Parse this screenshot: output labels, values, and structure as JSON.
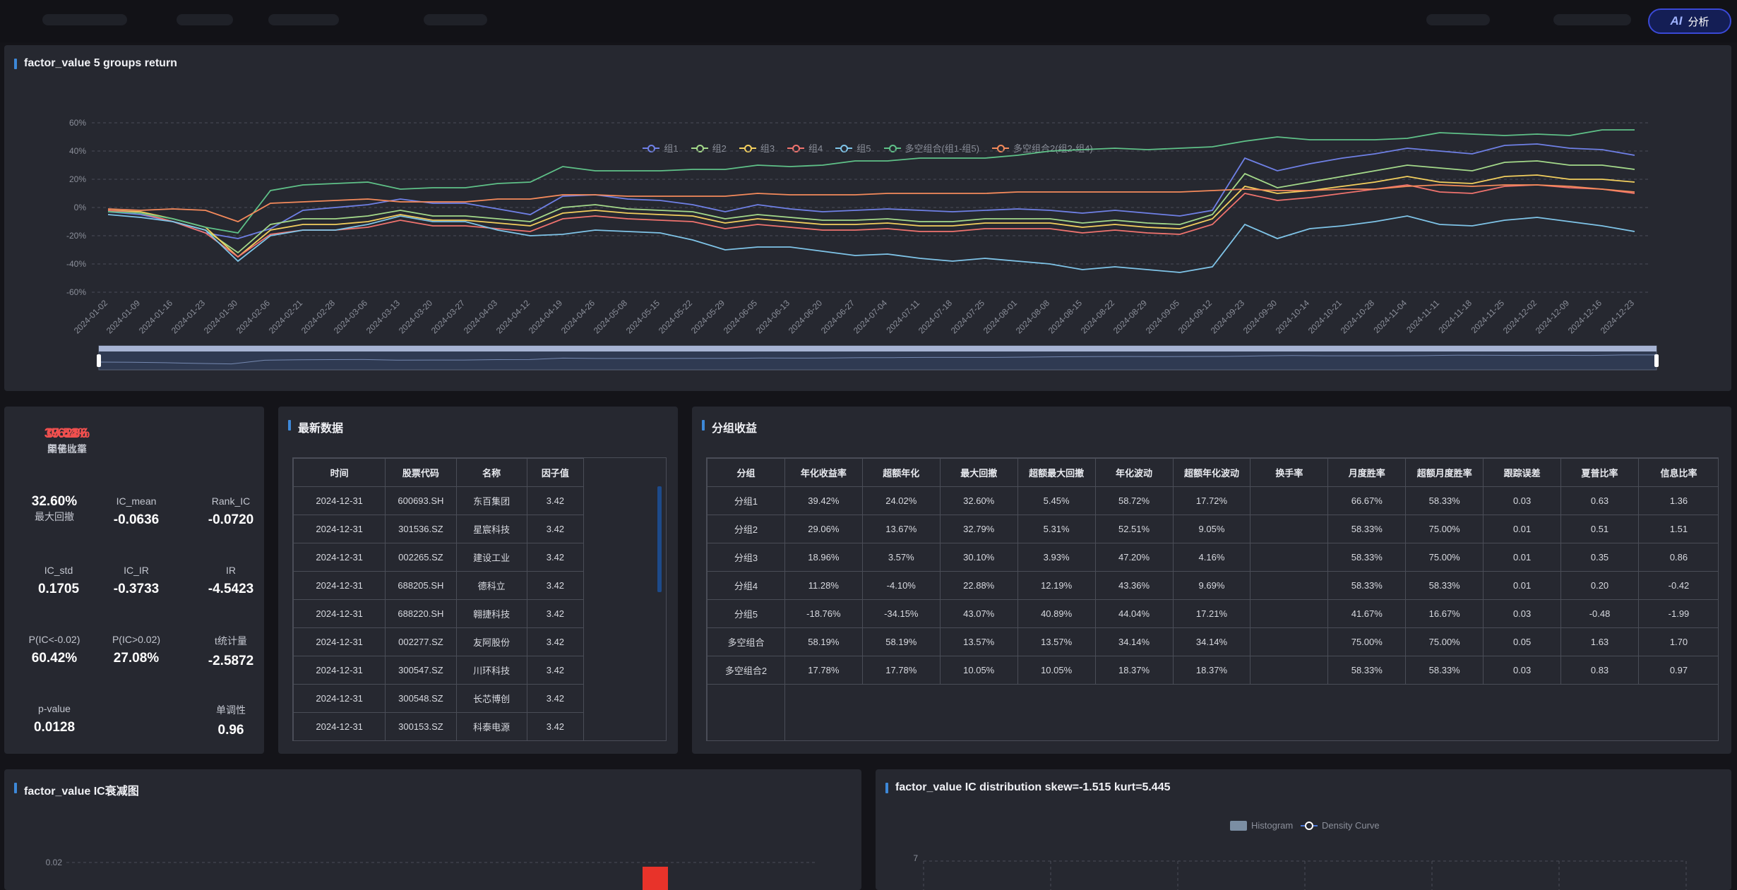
{
  "header": {
    "ai_label": "分析",
    "ai_icon": "AI"
  },
  "chart1": {
    "title": "factor_value 5 groups return",
    "legend": [
      {
        "name": "组1",
        "color": "#6f80e6"
      },
      {
        "name": "组2",
        "color": "#a4d98a"
      },
      {
        "name": "组3",
        "color": "#f3cf5e"
      },
      {
        "name": "组4",
        "color": "#f0736e"
      },
      {
        "name": "组5",
        "color": "#7fc4e8"
      },
      {
        "name": "多空组合(组1-组5)",
        "color": "#5fc188"
      },
      {
        "name": "多空组合2(组2-组4)",
        "color": "#f58a5b"
      }
    ]
  },
  "chart_data": [
    {
      "type": "line",
      "title": "factor_value 5 groups return",
      "x": [
        "2024-01-02",
        "2024-01-09",
        "2024-01-16",
        "2024-01-23",
        "2024-01-30",
        "2024-02-06",
        "2024-02-21",
        "2024-02-28",
        "2024-03-06",
        "2024-03-13",
        "2024-03-20",
        "2024-03-27",
        "2024-04-03",
        "2024-04-12",
        "2024-04-19",
        "2024-04-26",
        "2024-05-08",
        "2024-05-15",
        "2024-05-22",
        "2024-05-29",
        "2024-06-05",
        "2024-06-13",
        "2024-06-20",
        "2024-06-27",
        "2024-07-04",
        "2024-07-11",
        "2024-07-18",
        "2024-07-25",
        "2024-08-01",
        "2024-08-08",
        "2024-08-15",
        "2024-08-22",
        "2024-08-29",
        "2024-09-05",
        "2024-09-12",
        "2024-09-23",
        "2024-09-30",
        "2024-10-14",
        "2024-10-21",
        "2024-10-28",
        "2024-11-04",
        "2024-11-11",
        "2024-11-18",
        "2024-11-25",
        "2024-12-02",
        "2024-12-09",
        "2024-12-16",
        "2024-12-23"
      ],
      "yunit": "%",
      "ylim": [
        -60,
        60
      ],
      "yticks": [
        60,
        40,
        20,
        0,
        -20,
        -40,
        -60
      ],
      "grid": true,
      "legend": "top-center",
      "series": [
        {
          "name": "组1",
          "values": [
            -3,
            -5,
            -10,
            -18,
            -22,
            -15,
            -2,
            0,
            2,
            6,
            3,
            3,
            -1,
            -5,
            8,
            9,
            6,
            5,
            2,
            -3,
            2,
            -1,
            -3,
            -2,
            -1,
            -2,
            -3,
            -2,
            -1,
            -2,
            -4,
            -2,
            -4,
            -6,
            -2,
            35,
            26,
            31,
            35,
            38,
            42,
            40,
            38,
            44,
            45,
            42,
            41,
            37
          ]
        },
        {
          "name": "组2",
          "values": [
            -2,
            -4,
            -10,
            -16,
            -32,
            -12,
            -8,
            -8,
            -6,
            -2,
            -6,
            -6,
            -8,
            -10,
            0,
            2,
            -1,
            -2,
            -3,
            -8,
            -5,
            -7,
            -9,
            -9,
            -8,
            -10,
            -10,
            -8,
            -8,
            -8,
            -11,
            -9,
            -11,
            -12,
            -5,
            24,
            14,
            18,
            22,
            26,
            30,
            28,
            26,
            32,
            33,
            30,
            30,
            27
          ]
        },
        {
          "name": "组3",
          "values": [
            -2,
            -3,
            -8,
            -14,
            -35,
            -16,
            -12,
            -12,
            -10,
            -5,
            -9,
            -9,
            -11,
            -13,
            -4,
            -2,
            -4,
            -5,
            -6,
            -11,
            -8,
            -10,
            -12,
            -12,
            -11,
            -13,
            -13,
            -11,
            -11,
            -11,
            -14,
            -12,
            -14,
            -15,
            -8,
            15,
            10,
            12,
            15,
            18,
            22,
            18,
            17,
            22,
            23,
            20,
            20,
            18
          ]
        },
        {
          "name": "组4",
          "values": [
            -2,
            -4,
            -10,
            -18,
            -35,
            -19,
            -16,
            -16,
            -14,
            -9,
            -13,
            -13,
            -15,
            -17,
            -8,
            -6,
            -8,
            -9,
            -10,
            -15,
            -12,
            -14,
            -16,
            -16,
            -15,
            -17,
            -17,
            -15,
            -15,
            -15,
            -18,
            -16,
            -18,
            -19,
            -12,
            10,
            5,
            7,
            10,
            13,
            16,
            11,
            10,
            15,
            16,
            14,
            13,
            10
          ]
        },
        {
          "name": "组5",
          "values": [
            -5,
            -7,
            -10,
            -16,
            -38,
            -20,
            -16,
            -16,
            -12,
            -6,
            -10,
            -10,
            -16,
            -20,
            -19,
            -16,
            -17,
            -18,
            -23,
            -30,
            -28,
            -28,
            -31,
            -34,
            -33,
            -36,
            -38,
            -36,
            -38,
            -40,
            -44,
            -42,
            -44,
            -46,
            -42,
            -12,
            -22,
            -15,
            -13,
            -10,
            -6,
            -12,
            -13,
            -9,
            -7,
            -10,
            -13,
            -17
          ]
        },
        {
          "name": "多空组合(组1-组5)",
          "values": [
            -3,
            -4,
            -8,
            -14,
            -18,
            12,
            16,
            17,
            18,
            13,
            14,
            14,
            17,
            18,
            29,
            26,
            26,
            26,
            27,
            27,
            30,
            29,
            30,
            33,
            33,
            35,
            35,
            35,
            37,
            40,
            41,
            42,
            41,
            42,
            43,
            47,
            50,
            48,
            48,
            48,
            49,
            53,
            52,
            51,
            52,
            51,
            55,
            55
          ]
        },
        {
          "name": "多空组合2(组2-组4)",
          "values": [
            -1,
            -2,
            -1,
            -2,
            -10,
            3,
            4,
            5,
            6,
            4,
            4,
            4,
            6,
            6,
            9,
            9,
            8,
            8,
            8,
            8,
            10,
            9,
            9,
            9,
            10,
            10,
            10,
            10,
            11,
            11,
            11,
            11,
            11,
            11,
            12,
            13,
            12,
            12,
            13,
            13,
            15,
            16,
            15,
            16,
            16,
            15,
            13,
            11
          ]
        }
      ]
    },
    {
      "type": "bar",
      "title": "factor_value IC衰减图",
      "yticks": [
        0.02
      ],
      "series": [
        {
          "values": [
            0.02
          ]
        }
      ]
    },
    {
      "type": "bar",
      "title": "factor_value IC distribution skew=-1.515 kurt=5.445",
      "legend": [
        "Histogram",
        "Density Curve"
      ],
      "yticks": [
        7
      ]
    }
  ],
  "metrics": [
    {
      "value": "37.54%",
      "label": "因子收益",
      "highlight": true
    },
    {
      "value": "0.6286",
      "label": "夏普比率",
      "highlight": true
    },
    {
      "value": "39.42%",
      "label": "年化收益",
      "highlight": true
    },
    {
      "value": "32.60%",
      "label": "最大回撤"
    },
    {
      "value": "-0.0636",
      "label": "IC_mean"
    },
    {
      "value": "-0.0720",
      "label": "Rank_IC"
    },
    {
      "value": "0.1705",
      "label": "IC_std"
    },
    {
      "value": "-0.3733",
      "label": "IC_IR"
    },
    {
      "value": "-4.5423",
      "label": "IR"
    },
    {
      "value": "60.42%",
      "label": "P(IC<-0.02)"
    },
    {
      "value": "27.08%",
      "label": "P(IC>0.02)"
    },
    {
      "value": "-2.5872",
      "label": "t统计量"
    },
    {
      "value": "0.0128",
      "label": "p-value"
    },
    {
      "value": "0.96",
      "label": "单调性"
    }
  ],
  "latest": {
    "title": "最新数据",
    "headers": [
      "时间",
      "股票代码",
      "名称",
      "因子值"
    ],
    "rows": [
      [
        "2024-12-31",
        "600693.SH",
        "东百集团",
        "3.42"
      ],
      [
        "2024-12-31",
        "301536.SZ",
        "星宸科技",
        "3.42"
      ],
      [
        "2024-12-31",
        "002265.SZ",
        "建设工业",
        "3.42"
      ],
      [
        "2024-12-31",
        "688205.SH",
        "德科立",
        "3.42"
      ],
      [
        "2024-12-31",
        "688220.SH",
        "翱捷科技",
        "3.42"
      ],
      [
        "2024-12-31",
        "002277.SZ",
        "友阿股份",
        "3.42"
      ],
      [
        "2024-12-31",
        "300547.SZ",
        "川环科技",
        "3.42"
      ],
      [
        "2024-12-31",
        "300548.SZ",
        "长芯博创",
        "3.42"
      ],
      [
        "2024-12-31",
        "300153.SZ",
        "科泰电源",
        "3.42"
      ]
    ]
  },
  "groups": {
    "title": "分组收益",
    "headers": [
      "分组",
      "年化收益率",
      "超额年化",
      "最大回撤",
      "超额最大回撤",
      "年化波动",
      "超额年化波动",
      "换手率",
      "月度胜率",
      "超额月度胜率",
      "跟踪误差",
      "夏普比率",
      "信息比率"
    ],
    "rows": [
      [
        "分组1",
        "39.42%",
        "24.02%",
        "32.60%",
        "5.45%",
        "58.72%",
        "17.72%",
        "",
        "66.67%",
        "58.33%",
        "0.03",
        "0.63",
        "1.36"
      ],
      [
        "分组2",
        "29.06%",
        "13.67%",
        "32.79%",
        "5.31%",
        "52.51%",
        "9.05%",
        "",
        "58.33%",
        "75.00%",
        "0.01",
        "0.51",
        "1.51"
      ],
      [
        "分组3",
        "18.96%",
        "3.57%",
        "30.10%",
        "3.93%",
        "47.20%",
        "4.16%",
        "",
        "58.33%",
        "75.00%",
        "0.01",
        "0.35",
        "0.86"
      ],
      [
        "分组4",
        "11.28%",
        "-4.10%",
        "22.88%",
        "12.19%",
        "43.36%",
        "9.69%",
        "",
        "58.33%",
        "58.33%",
        "0.01",
        "0.20",
        "-0.42"
      ],
      [
        "分组5",
        "-18.76%",
        "-34.15%",
        "43.07%",
        "40.89%",
        "44.04%",
        "17.21%",
        "",
        "41.67%",
        "16.67%",
        "0.03",
        "-0.48",
        "-1.99"
      ],
      [
        "多空组合",
        "58.19%",
        "58.19%",
        "13.57%",
        "13.57%",
        "34.14%",
        "34.14%",
        "",
        "75.00%",
        "75.00%",
        "0.05",
        "1.63",
        "1.70"
      ],
      [
        "多空组合2",
        "17.78%",
        "17.78%",
        "10.05%",
        "10.05%",
        "18.37%",
        "18.37%",
        "",
        "58.33%",
        "58.33%",
        "0.03",
        "0.83",
        "0.97"
      ]
    ]
  },
  "ic_decay": {
    "title": "factor_value IC衰减图",
    "ytick": "0.02",
    "bar_color": "#e8332a"
  },
  "ic_dist": {
    "title": "factor_value IC distribution skew=-1.515 kurt=5.445",
    "legend_hist": "Histogram",
    "legend_density": "Density Curve",
    "ytick": "7"
  }
}
